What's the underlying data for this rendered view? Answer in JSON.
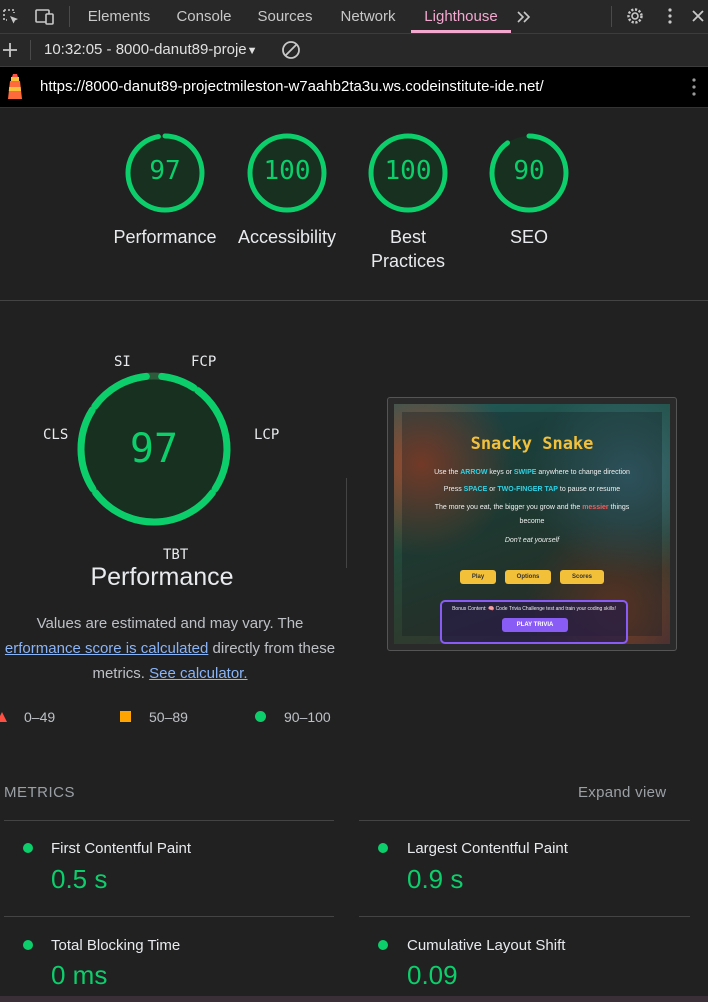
{
  "toolbar": {
    "tabs": [
      "Elements",
      "Console",
      "Sources",
      "Network",
      "Lighthouse"
    ],
    "active_tab": "Lighthouse",
    "more_tabs_icon": "chevron-double-right",
    "accent": "#f4a8d0"
  },
  "session": {
    "label": "10:32:05 - 8000-danut89-proje"
  },
  "urlbar": {
    "url": "https://8000-danut89-projectmileston-w7aahb2ta3u.ws.codeinstitute-ide.net/"
  },
  "summary_gauges": [
    {
      "score": "97",
      "label_lines": [
        "Performance"
      ]
    },
    {
      "score": "100",
      "label_lines": [
        "Accessibility"
      ]
    },
    {
      "score": "100",
      "label_lines": [
        "Best",
        "Practices"
      ]
    },
    {
      "score": "90",
      "label_lines": [
        "SEO"
      ]
    }
  ],
  "performance": {
    "score": "97",
    "title": "Performance",
    "labels": {
      "si": "SI",
      "fcp": "FCP",
      "lcp": "LCP",
      "cls": "CLS",
      "tbt": "TBT"
    },
    "description_1": "Values are estimated and may vary. The",
    "description_link": "erformance score is calculated",
    "description_2": "directly from these",
    "description_3": "metrics.",
    "calculator_link": "See calculator.",
    "legend": [
      {
        "range": "0–49",
        "shape": "triangle",
        "color": "#ff4e42"
      },
      {
        "range": "50–89",
        "shape": "square",
        "color": "#ffa400"
      },
      {
        "range": "90–100",
        "shape": "circle",
        "color": "#0cce6b"
      }
    ],
    "good_color": "#0cce6b"
  },
  "preview": {
    "title": "Snacky Snake",
    "line1_a": "Use the",
    "line1_b": "ARROW",
    "line1_c": "keys or",
    "line1_d": "SWIPE",
    "line1_e": "anywhere to change direction",
    "line2_a": "Press",
    "line2_b": "SPACE",
    "line2_c": "or",
    "line2_d": "TWO-FINGER TAP",
    "line2_e": "to pause or resume",
    "line3_a": "The more you eat, the bigger you grow and the",
    "line3_b": "messier",
    "line3_c": "things",
    "line3_d": "become",
    "line4": "Don't eat yourself",
    "buttons": [
      "Play",
      "Options",
      "Scores"
    ],
    "bonus": "Bonus Content: 🧠 Code Trivia Challenge test and train your coding skills!",
    "trivia_button": "PLAY TRIVIA"
  },
  "metrics": {
    "heading": "METRICS",
    "expand": "Expand view",
    "items": [
      {
        "name": "First Contentful Paint",
        "value": "0.5 s"
      },
      {
        "name": "Largest Contentful Paint",
        "value": "0.9 s"
      },
      {
        "name": "Total Blocking Time",
        "value": "0 ms"
      },
      {
        "name": "Cumulative Layout Shift",
        "value": "0.09"
      }
    ]
  }
}
